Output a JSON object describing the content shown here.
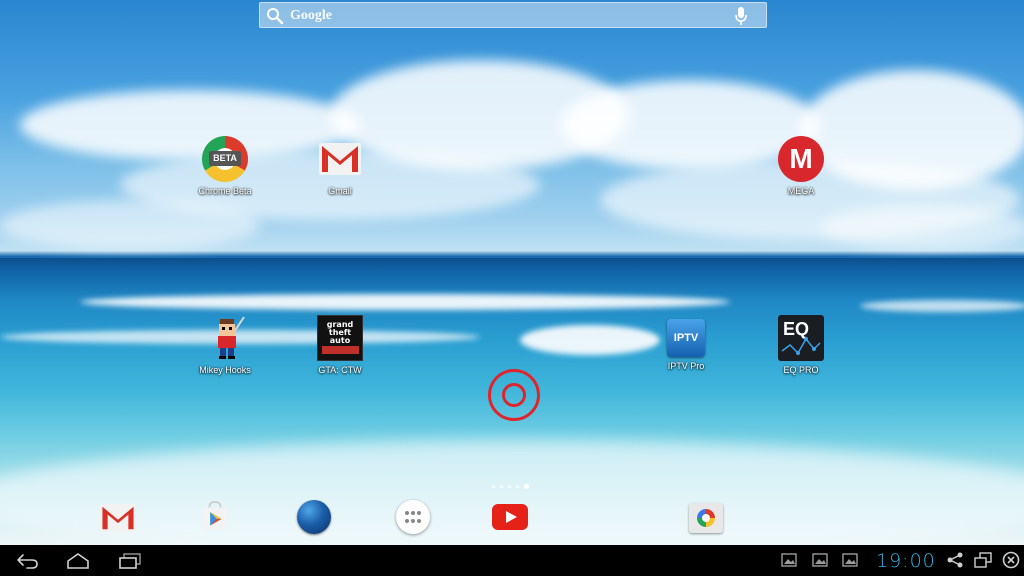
{
  "search": {
    "label": "Google"
  },
  "apps": [
    {
      "id": "chrome-beta",
      "label": "Chrome Beta",
      "badge": "BETA"
    },
    {
      "id": "gmail",
      "label": "Gmail"
    },
    {
      "id": "mega",
      "label": "MEGA",
      "glyph": "M"
    },
    {
      "id": "mikey-hooks",
      "label": "Mikey Hooks"
    },
    {
      "id": "gta-ctw",
      "label": "GTA: CTW",
      "art": "grand theft auto"
    },
    {
      "id": "iptv-pro",
      "label": "IPTV Pro",
      "glyph": "IPTV"
    },
    {
      "id": "eq-pro",
      "label": "EQ PRO",
      "glyph": "EQ"
    }
  ],
  "dock": [
    "gmail-icon",
    "play-store-icon",
    "earth-icon",
    "all-apps-icon",
    "youtube-icon",
    "camera-icon"
  ],
  "pages": {
    "count": 5,
    "active": 4
  },
  "navbar": {
    "buttons": [
      "back-icon",
      "home-icon",
      "recent-apps-icon"
    ],
    "clock": "19:00",
    "status_icons": [
      "notification-image-icon",
      "notification-image-icon",
      "notification-image-icon",
      "share-icon",
      "window-icon",
      "close-icon"
    ]
  },
  "colors": {
    "clock": "#33b5e5",
    "touch_indicator": "#e0242b"
  }
}
